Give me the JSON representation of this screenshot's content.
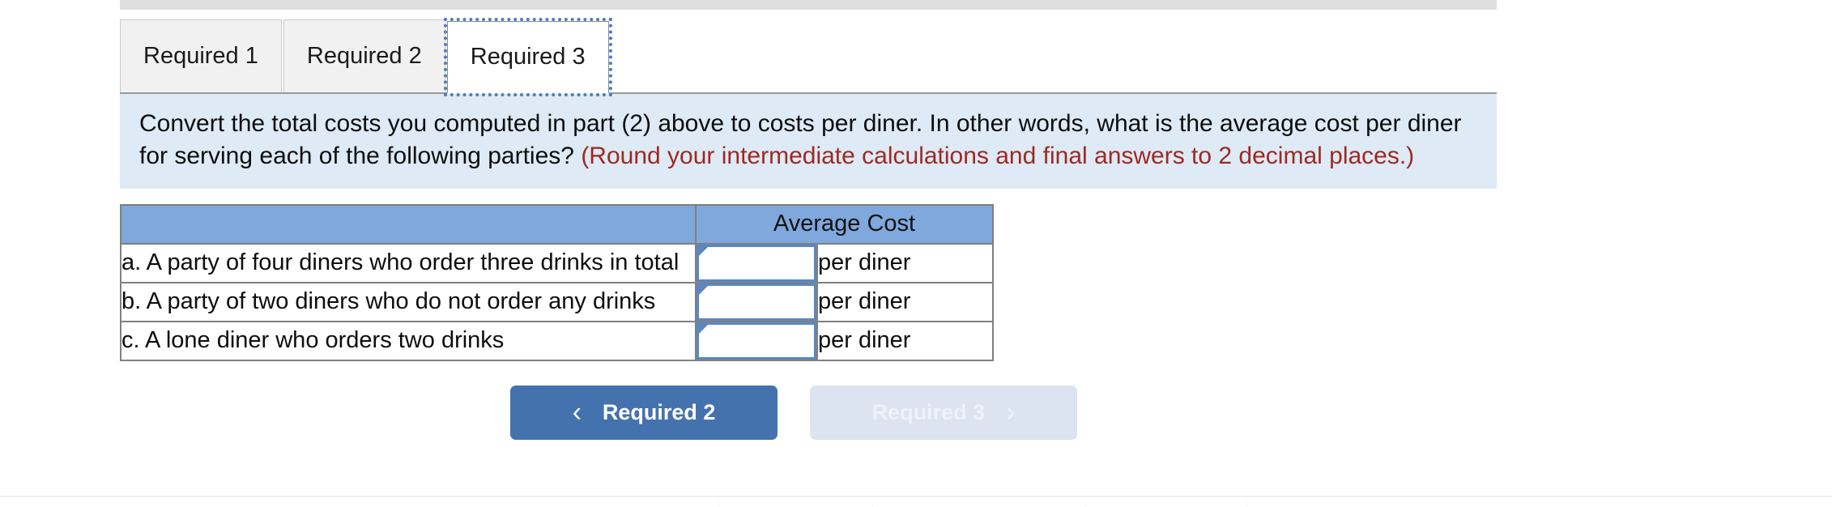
{
  "tabs": [
    {
      "label": "Required 1",
      "active": false
    },
    {
      "label": "Required 2",
      "active": false
    },
    {
      "label": "Required 3",
      "active": true
    }
  ],
  "instruction": {
    "text": "Convert the total costs you computed in part (2) above to costs per diner. In other words, what is the average cost per diner for serving each of the following parties?",
    "note": "(Round your intermediate calculations and final answers to 2 decimal places.)",
    "note_color": "#9c2a22",
    "background": "#deeaf6"
  },
  "table": {
    "header": {
      "blank": "",
      "average_cost": "Average Cost",
      "background": "#7fa8dc"
    },
    "rows": [
      {
        "label": "a. A party of four diners who order three drinks in total",
        "value": "",
        "unit": "per diner"
      },
      {
        "label": "b. A party of two diners who do not order any drinks",
        "value": "",
        "unit": "per diner"
      },
      {
        "label": "c. A lone diner who orders two drinks",
        "value": "",
        "unit": "per diner"
      }
    ]
  },
  "navigation": {
    "prev_label": "Required 2",
    "prev_icon": "chevron-left-icon",
    "prev_glyph": "‹",
    "prev_color": "#4472ae",
    "next_label": "Required 3",
    "next_icon": "chevron-right-icon",
    "next_glyph": "›",
    "next_color": "#dbe4f0"
  }
}
